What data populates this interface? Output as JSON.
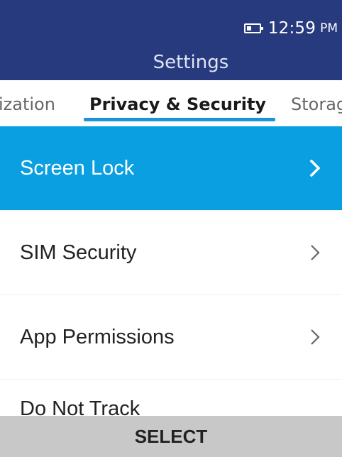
{
  "status_bar": {
    "battery_icon": "battery-icon",
    "time": "12:59",
    "ampm": "PM"
  },
  "header": {
    "title": "Settings"
  },
  "tabs": [
    {
      "label": "ization"
    },
    {
      "label": "Privacy & Security",
      "active": true
    },
    {
      "label": "Storag"
    }
  ],
  "list": {
    "items": [
      {
        "label": "Screen Lock",
        "selected": true,
        "icon": "chevron-right-icon"
      },
      {
        "label": "SIM Security",
        "icon": "chevron-right-icon"
      },
      {
        "label": "App Permissions",
        "icon": "chevron-right-icon"
      },
      {
        "label": "Do Not Track",
        "icon": "chevron-right-icon"
      }
    ]
  },
  "softkey": {
    "center_label": "SELECT"
  },
  "colors": {
    "header_bg": "#273a7e",
    "selected_bg": "#0a9fe0",
    "tab_underline": "#1a94d8",
    "softkey_bg": "#c8c8c8"
  }
}
